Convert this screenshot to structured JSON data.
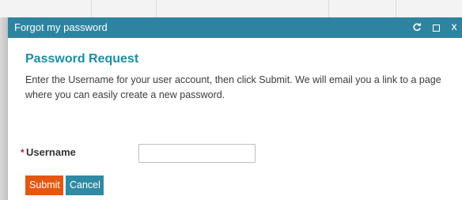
{
  "dialog": {
    "title": "Forgot my password",
    "controls": {
      "refresh_icon": "refresh-icon",
      "maximize_icon": "maximize-icon",
      "close_glyph": "x"
    },
    "heading": "Password Request",
    "description": "Enter the Username for your user account, then click Submit. We will email you a link to a page where you can easily create a new password.",
    "form": {
      "required_marker": "*",
      "username_label": "Username",
      "username_value": "",
      "username_placeholder": ""
    },
    "buttons": {
      "submit_label": "Submit",
      "cancel_label": "Cancel"
    }
  },
  "colors": {
    "titlebar": "#2e84a0",
    "heading": "#1a8da7",
    "submit": "#e4570e",
    "cancel": "#2f8aa3",
    "required": "#cc1f1f"
  }
}
